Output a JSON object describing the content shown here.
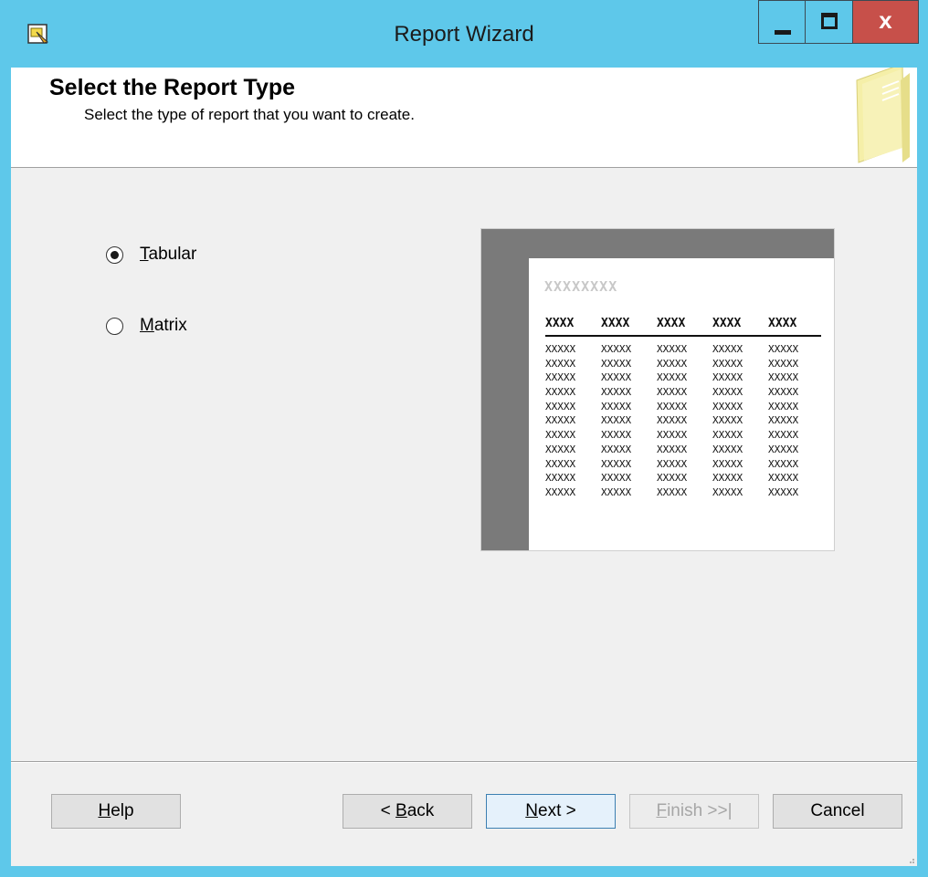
{
  "window": {
    "title": "Report Wizard",
    "minimize_icon": "minimize-icon",
    "maximize_icon": "maximize-icon",
    "close_label": "x"
  },
  "header": {
    "title": "Select the Report Type",
    "subtitle": "Select the type of report that you want to create.",
    "icon": "report-document-icon"
  },
  "options": [
    {
      "mnemonic": "T",
      "rest": "abular",
      "label": "Tabular",
      "selected": true
    },
    {
      "mnemonic": "M",
      "rest": "atrix",
      "label": "Matrix",
      "selected": false
    }
  ],
  "preview": {
    "title": "XXXXXXXX",
    "headers": [
      "XXXX",
      "XXXX",
      "XXXX",
      "XXXX",
      "XXXX"
    ],
    "cell": "XXXXX",
    "row_count": 11
  },
  "buttons": {
    "help": {
      "mnemonic": "H",
      "rest": "elp"
    },
    "back": {
      "pre": "< ",
      "mnemonic": "B",
      "rest": "ack"
    },
    "next": {
      "mnemonic": "N",
      "rest": "ext >"
    },
    "finish": {
      "mnemonic": "F",
      "rest": "inish >>|",
      "enabled": false
    },
    "cancel": {
      "label": "Cancel"
    }
  },
  "colors": {
    "titlebar": "#5ec8ea",
    "close_button": "#c7504a",
    "dialog_bg": "#f0f0f0",
    "default_button_border": "#3c7fb1"
  }
}
